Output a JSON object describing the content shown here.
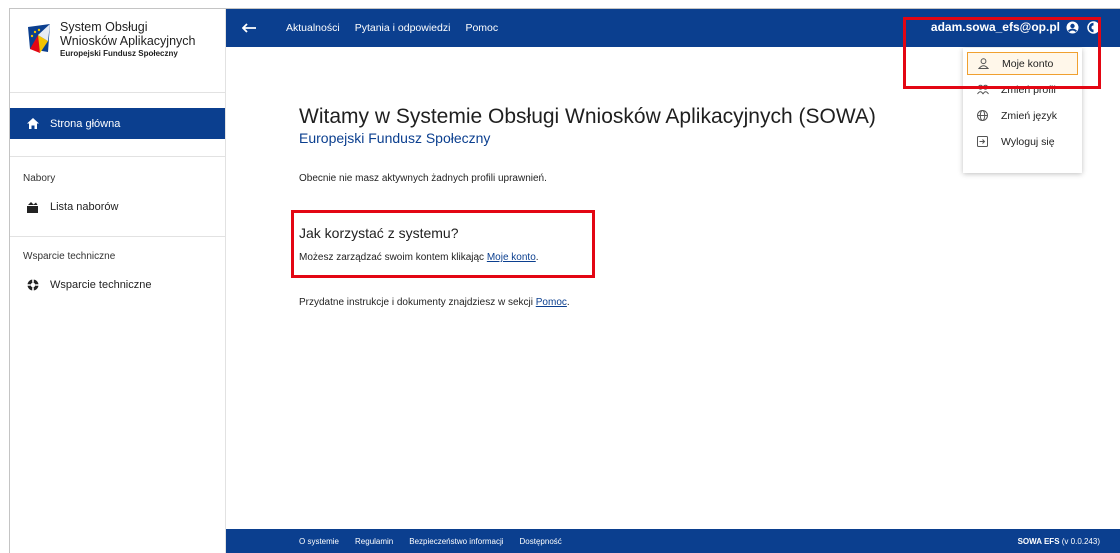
{
  "sidebar": {
    "logo_line1": "System Obsługi",
    "logo_line2": "Wniosków Aplikacyjnych",
    "logo_line3": "Europejski Fundusz Społeczny",
    "home_label": "Strona główna",
    "section_nabory": "Nabory",
    "lista_naborow": "Lista naborów",
    "section_wsparcie": "Wsparcie techniczne",
    "wsparcie_item": "Wsparcie techniczne"
  },
  "topbar": {
    "links": [
      "Aktualności",
      "Pytania i odpowiedzi",
      "Pomoc"
    ],
    "user_email": "adam.sowa_efs@op.pl"
  },
  "dropdown": {
    "items": [
      "Moje konto",
      "Zmień profil",
      "Zmień język",
      "Wyloguj się"
    ]
  },
  "main": {
    "title": "Witamy w Systemie Obsługi Wniosków Aplikacyjnych (SOWA)",
    "subtitle": "Europejski Fundusz Społeczny",
    "no_profiles": "Obecnie nie masz aktywnych żadnych profili uprawnień.",
    "help_title": "Jak korzystać z systemu?",
    "help_text_before": "Możesz zarządzać swoim kontem klikając ",
    "help_link": "Moje konto",
    "help_text_after": ".",
    "instr_before": "Przydatne instrukcje i dokumenty znajdziesz w sekcji ",
    "instr_link": "Pomoc",
    "instr_after": "."
  },
  "footer": {
    "links": [
      "O systemie",
      "Regulamin",
      "Bezpieczeństwo informacji",
      "Dostępność"
    ],
    "version_name": "SOWA EFS",
    "version_number": " (v 0.0.243)"
  },
  "colors": {
    "brand_blue": "#0b3f8f",
    "highlight_red": "#e30613",
    "active_orange": "#f0a030"
  }
}
